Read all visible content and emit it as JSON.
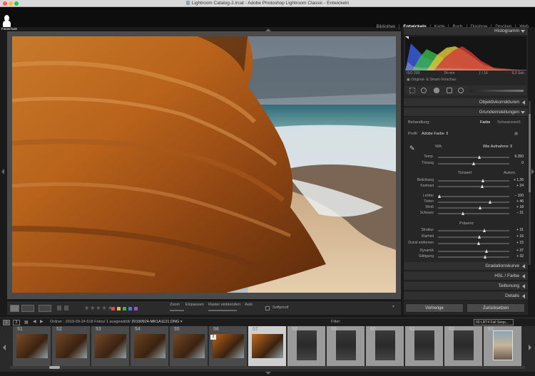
{
  "window": {
    "title": "Lightroom Catalog-2.lrcat - Adobe Photoshop Lightroom Classic - Entwickeln"
  },
  "header": {
    "logo_text": "Fotoschule",
    "modules": [
      "Bibliothek",
      "Entwickeln",
      "Karte",
      "Buch",
      "Diashow",
      "Drucken",
      "Web"
    ],
    "active_module": "Entwickeln"
  },
  "toolbar": {
    "stars": "★★★★★",
    "zoom_label": "Zoom",
    "zoom_value": "Einpassen",
    "grid_label": "Raster einblenden:",
    "grid_value": "Auto",
    "softproof_label": "Softproof",
    "color_labels": [
      "#d24a4a",
      "#d8c038",
      "#4caa4c",
      "#4a78d0",
      "#9a55c0"
    ]
  },
  "panel": {
    "histogram_title": "Histogramm",
    "exif": [
      "ISO 200",
      "24 mm",
      "ƒ / 16",
      "6,0 Sek."
    ],
    "preview_label": "Original- & Smart-Vorschau",
    "lens_title": "Objektivkorrekturen",
    "basic_title": "Grundeinstellungen",
    "treatment_label": "Behandlung:",
    "treatment_color": "Farbe",
    "treatment_bw": "Schwarzweiß",
    "profile_label": "Profil:",
    "profile_value": "Adobe Farbe",
    "wb_label": "WA:",
    "wb_value": "Wie Aufnahme",
    "tone_label": "Tonwert",
    "tone_auto": "Autom.",
    "presence_label": "Präsenz",
    "sliders_wb": [
      {
        "label": "Temp.",
        "value": "6.350",
        "pos": 0.58
      },
      {
        "label": "Tönung",
        "value": "0",
        "pos": 0.5
      }
    ],
    "sliders_tone": [
      {
        "label": "Belichtung",
        "value": "+ 1,26",
        "pos": 0.63
      },
      {
        "label": "Kontrast",
        "value": "+ 24",
        "pos": 0.62
      }
    ],
    "sliders_tone2": [
      {
        "label": "Lichter",
        "value": "− 100",
        "pos": 0.02
      },
      {
        "label": "Tiefen",
        "value": "+ 46",
        "pos": 0.73
      },
      {
        "label": "Weiß",
        "value": "+ 18",
        "pos": 0.59
      },
      {
        "label": "Schwarz",
        "value": "− 31",
        "pos": 0.35
      }
    ],
    "sliders_presence": [
      {
        "label": "Struktur",
        "value": "+ 31",
        "pos": 0.65
      },
      {
        "label": "Klarheit",
        "value": "+ 16",
        "pos": 0.58
      },
      {
        "label": "Dunst entfernen",
        "value": "+ 15",
        "pos": 0.57
      }
    ],
    "sliders_presence2": [
      {
        "label": "Dynamik",
        "value": "+ 37",
        "pos": 0.68
      },
      {
        "label": "Sättigung",
        "value": "+ 32",
        "pos": 0.66
      }
    ],
    "curve_title": "Gradationskurve",
    "hsl_title": "HSL / Farbe",
    "split_title": "Teiltonung",
    "details_title": "Details",
    "prev_button": "Vorherige",
    "reset_button": "Zurücksetzen"
  },
  "filmstrip": {
    "page1": "1",
    "page2": "2",
    "path_prefix": "Ordner : 2019-09-24",
    "count": "618 Fotos/ 1 ausgewählt/",
    "filename": "20190924-MK1A1121.DNG",
    "filter_label": "Filter:",
    "preset": "00 LRT4 Full Sequ...",
    "cells": [
      {
        "n": "51"
      },
      {
        "n": "52"
      },
      {
        "n": "53"
      },
      {
        "n": "54"
      },
      {
        "n": "55"
      },
      {
        "n": "56"
      },
      {
        "n": "57"
      },
      {
        "n": "58"
      },
      {
        "n": "59"
      },
      {
        "n": "60"
      },
      {
        "n": "61"
      },
      {
        "n": "62"
      },
      {
        "n": "63"
      }
    ],
    "badge": "2"
  }
}
